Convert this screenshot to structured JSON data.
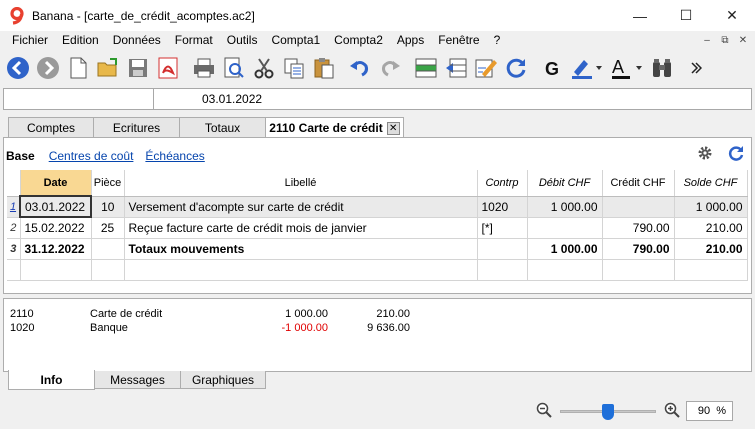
{
  "window": {
    "title": "Banana - [carte_de_crédit_acomptes.ac2]",
    "minimize": "—",
    "maximize": "☐",
    "close": "✕"
  },
  "menu": [
    "Fichier",
    "Edition",
    "Données",
    "Format",
    "Outils",
    "Compta1",
    "Compta2",
    "Apps",
    "Fenêtre",
    "?"
  ],
  "mdi": {
    "minimize": "–",
    "restore": "⧉",
    "close": "✕"
  },
  "cell": {
    "reference": "",
    "value": "03.01.2022"
  },
  "tabs": [
    {
      "label": "Comptes"
    },
    {
      "label": "Ecritures"
    },
    {
      "label": "Totaux"
    },
    {
      "label": "2110 Carte de crédit",
      "active": true
    }
  ],
  "views": [
    "Base",
    "Centres de coût",
    "Échéances"
  ],
  "table": {
    "columns": [
      "",
      "Date",
      "Pièce",
      "Libellé",
      "Contrp",
      "Débit CHF",
      "Crédit CHF",
      "Solde CHF"
    ],
    "rows": [
      {
        "num": "1",
        "date": "03.01.2022",
        "doc": "10",
        "desc": "Versement d'acompte sur carte de crédit",
        "contra": "1020",
        "debit": "1 000.00",
        "credit": "",
        "balance": "1 000.00"
      },
      {
        "num": "2",
        "date": "15.02.2022",
        "doc": "25",
        "desc": "Reçue facture carte de crédit mois de janvier",
        "contra": "[*]",
        "debit": "",
        "credit": "790.00",
        "balance": "210.00"
      },
      {
        "num": "3",
        "date": "31.12.2022",
        "doc": "",
        "desc": "Totaux  mouvements",
        "contra": "",
        "debit": "1 000.00",
        "credit": "790.00",
        "balance": "210.00"
      }
    ]
  },
  "info": [
    {
      "account": "2110",
      "desc": "Carte de crédit",
      "v1": "1 000.00",
      "v2": "210.00"
    },
    {
      "account": "1020",
      "desc": "Banque",
      "v1": "-1 000.00",
      "v2": "9 636.00"
    }
  ],
  "bottom_tabs": [
    {
      "label": "Info",
      "active": true
    },
    {
      "label": "Messages"
    },
    {
      "label": "Graphiques"
    }
  ],
  "zoom": {
    "value": "90",
    "unit": "%",
    "level": 0.5
  },
  "colors": {
    "active_column": "#f9d893",
    "link": "#0645ad",
    "negative": "#e00000",
    "accent": "#1e6fd9"
  }
}
